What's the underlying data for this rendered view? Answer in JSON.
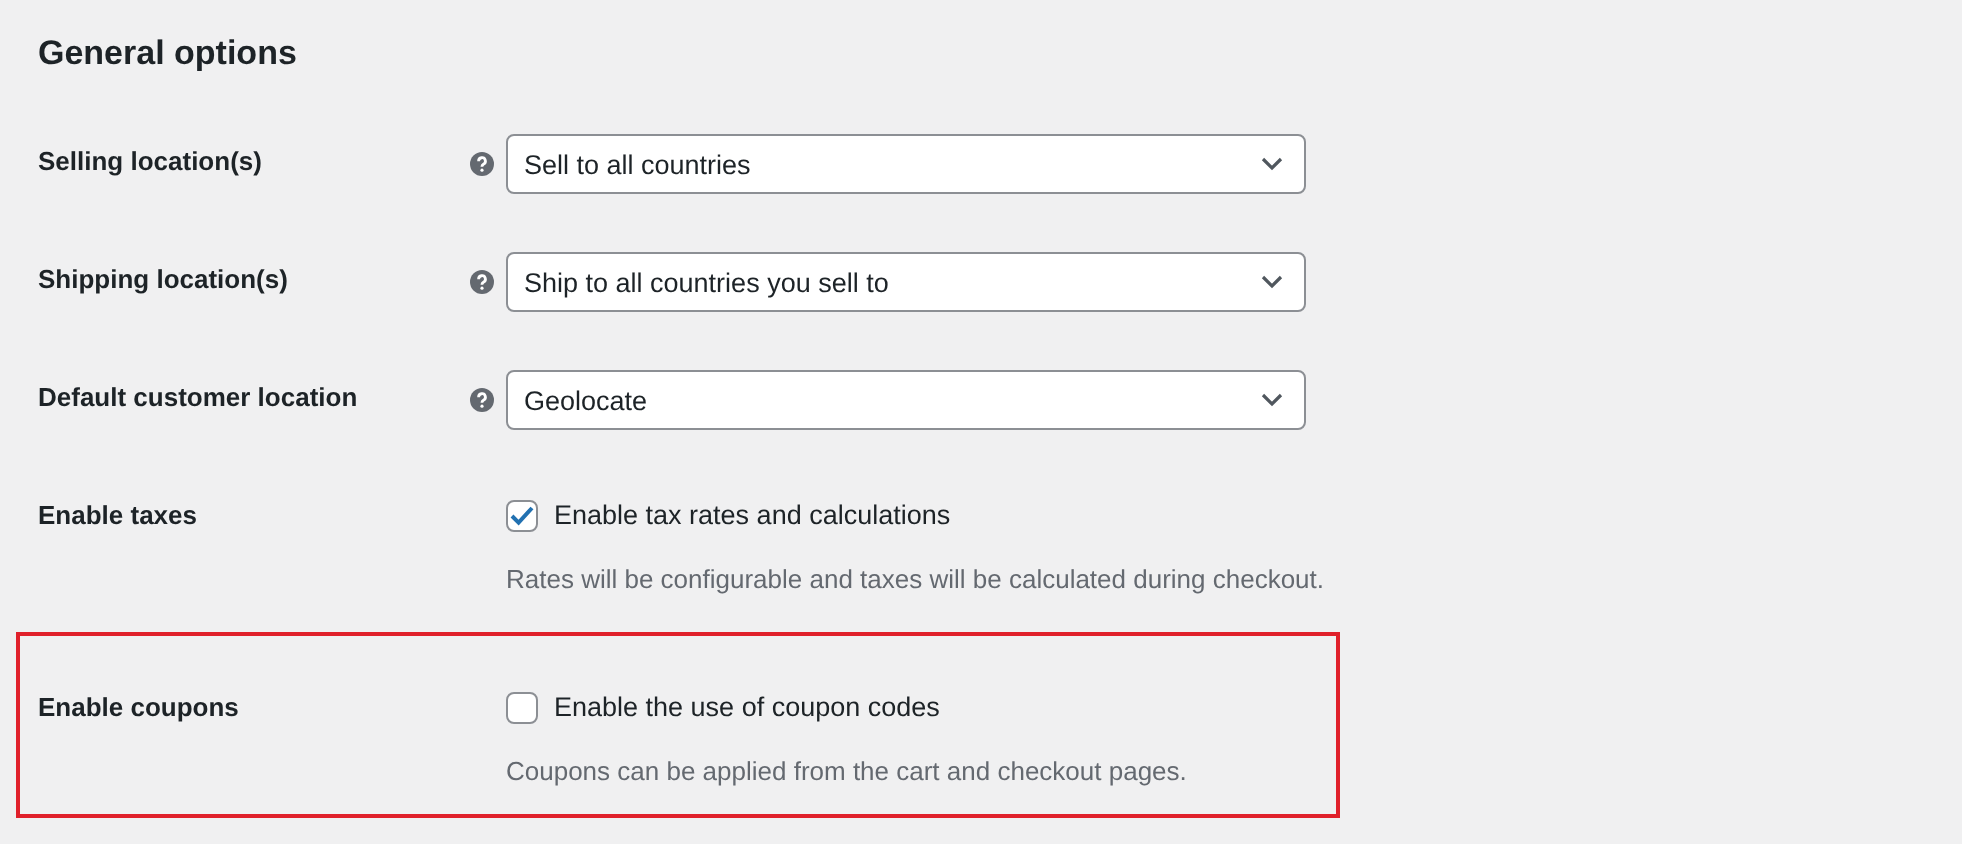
{
  "section_title": "General options",
  "settings": [
    {
      "kind": "select",
      "label": "Selling location(s)",
      "help": true,
      "value": "Sell to all countries",
      "highlighted": false
    },
    {
      "kind": "select",
      "label": "Shipping location(s)",
      "help": true,
      "value": "Ship to all countries you sell to",
      "highlighted": false
    },
    {
      "kind": "select",
      "label": "Default customer location",
      "help": true,
      "value": "Geolocate",
      "highlighted": false
    },
    {
      "kind": "checkbox",
      "label": "Enable taxes",
      "option": "Enable tax rates and calculations",
      "checked": true,
      "description": "Rates will be configurable and taxes will be calculated during checkout.",
      "highlighted": false
    },
    {
      "kind": "checkbox",
      "label": "Enable coupons",
      "option": "Enable the use of coupon codes",
      "checked": false,
      "description": "Coupons can be applied from the cart and checkout pages.",
      "highlighted": true
    }
  ]
}
